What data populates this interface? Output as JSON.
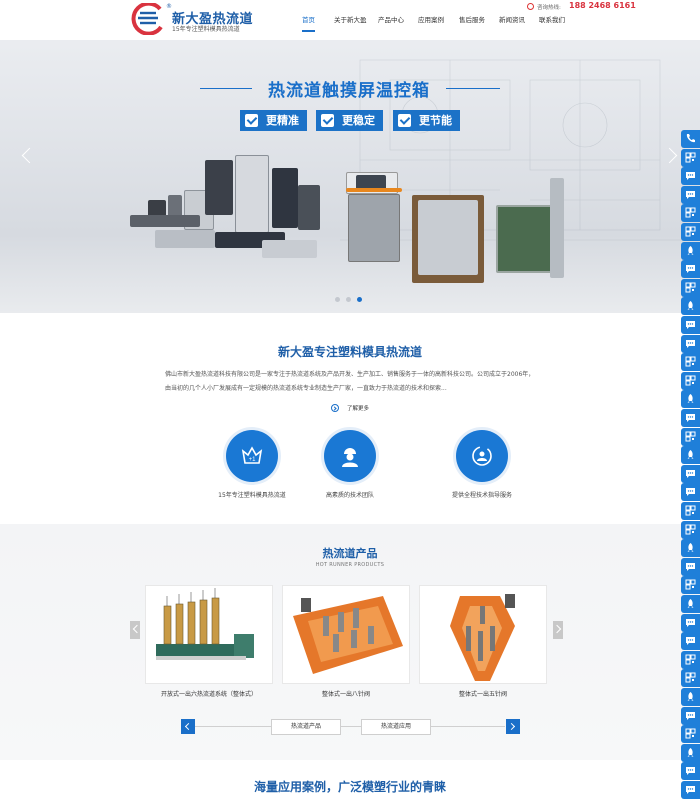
{
  "header": {
    "logo_name": "新大盈热流道",
    "logo_reg": "®",
    "logo_sub": "15年专注塑料模具热流道",
    "hotline_label": "咨询热线:",
    "hotline_number": "188 2468 6161",
    "nav": [
      "首页",
      "关于新大盈",
      "产品中心",
      "应用案例",
      "售后服务",
      "新闻资讯",
      "联系我们"
    ],
    "active_nav": 0
  },
  "banner": {
    "title": "热流道触摸屏温控箱",
    "tags": [
      "更精准",
      "更稳定",
      "更节能"
    ],
    "slide_count": 3,
    "active_slide": 2
  },
  "about": {
    "title": "新大盈专注塑料模具热流道",
    "description": "佛山市新大盈热流道科技有限公司是一家专注于热流道系统及产品开发、生产加工、销售服务于一体的高新科技公司。公司成立于2006年，由当初的几个人小厂发展成有一定规模的热流道系统专业制造生产厂家，一直致力于热流道的技术和探索...",
    "more_label": "了解更多",
    "features": [
      {
        "label": "15年专注塑料模具热流道",
        "icon": "crown-icon"
      },
      {
        "label": "高素质的技术团队",
        "icon": "engineer-icon"
      },
      {
        "label": "提供全程技术指导服务",
        "icon": "service-icon"
      }
    ]
  },
  "products": {
    "title": "热流道产品",
    "subtitle": "HOT RUNNER PRODUCTS",
    "items": [
      {
        "caption": "开放式一出六热流道系统（整体式）"
      },
      {
        "caption": "整体式一出八针阀"
      },
      {
        "caption": "整体式一出五针阀"
      }
    ],
    "tabs": [
      "热流道产品",
      "热流道应用"
    ]
  },
  "cases": {
    "title": "海量应用案例，广泛模塑行业的青睐"
  },
  "float_bar": {
    "icons": [
      "phone-icon",
      "qr-icon",
      "chat-icon",
      "chat-icon",
      "qr-icon",
      "qr-icon",
      "rocket-icon",
      "chat-icon",
      "qr-icon",
      "rocket-icon",
      "chat-icon",
      "chat-icon",
      "qr-icon",
      "qr-icon",
      "rocket-icon",
      "chat-icon",
      "qr-icon",
      "rocket-icon",
      "chat-icon",
      "chat-icon",
      "qr-icon",
      "qr-icon",
      "rocket-icon",
      "chat-icon",
      "qr-icon",
      "rocket-icon",
      "chat-icon",
      "chat-icon",
      "qr-icon",
      "qr-icon",
      "rocket-icon",
      "chat-icon",
      "qr-icon",
      "rocket-icon",
      "chat-icon",
      "chat-icon"
    ]
  },
  "colors": {
    "brand_blue": "#1a6fc9",
    "hotline_red": "#d9333f",
    "float_blue": "#1f7fd9"
  }
}
